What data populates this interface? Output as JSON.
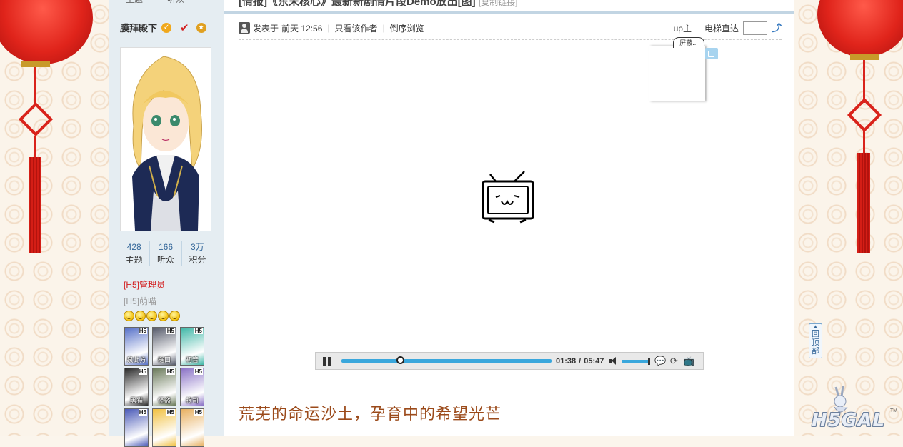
{
  "sidebar": {
    "top_cut": [
      "主题",
      "听众"
    ],
    "username": "膜拜殿下",
    "stats": [
      {
        "value": "428",
        "label": "主题"
      },
      {
        "value": "166",
        "label": "听众"
      },
      {
        "value": "3万",
        "label": "积分"
      }
    ],
    "group_primary": "[H5]管理员",
    "group_secondary": "[H5]萌喵",
    "medals": [
      {
        "name": "泉此方",
        "tag": "H5",
        "color": "#5570c8"
      },
      {
        "name": "樋口",
        "tag": "H5",
        "color": "#555a6a"
      },
      {
        "name": "初音",
        "tag": "H5",
        "color": "#3fb7a7"
      },
      {
        "name": "黑猫",
        "tag": "H5",
        "color": "#2b2b2b"
      },
      {
        "name": "怪盗",
        "tag": "H5",
        "color": "#6a7a5a"
      },
      {
        "name": "柊司",
        "tag": "H5",
        "color": "#8a72c6"
      },
      {
        "name": "",
        "tag": "H5",
        "color": "#4a5ab8"
      },
      {
        "name": "",
        "tag": "H5",
        "color": "#f1c040"
      },
      {
        "name": "",
        "tag": "H5",
        "color": "#e8b060"
      }
    ]
  },
  "post": {
    "title": "[情报]《东末核心》最新新剧情片段Demo放出[图]",
    "title_suffix": "[复制链接]",
    "posted_prefix": "发表于",
    "posted_time": "前天 12:56",
    "only_author": "只看该作者",
    "reverse_browse": "倒序浏览",
    "up_owner": "up主",
    "elevator": "电梯直达",
    "headline": "荒芜的命运沙土，孕育中的希望光芒"
  },
  "player": {
    "danmaku_tab": "屏蔽...",
    "current_time": "01:38",
    "total_time": "05:47",
    "progress": 0.28
  },
  "page": {
    "back_to_top": [
      "回",
      "顶",
      "部"
    ],
    "brand": "H5GAL",
    "brand_tm": "TM"
  },
  "colors": {
    "accent_blue": "#3aa7dc",
    "headline_brown": "#9b4a1a",
    "sidebar_bg": "#e5edf2",
    "admin_red": "#d21d1d"
  }
}
